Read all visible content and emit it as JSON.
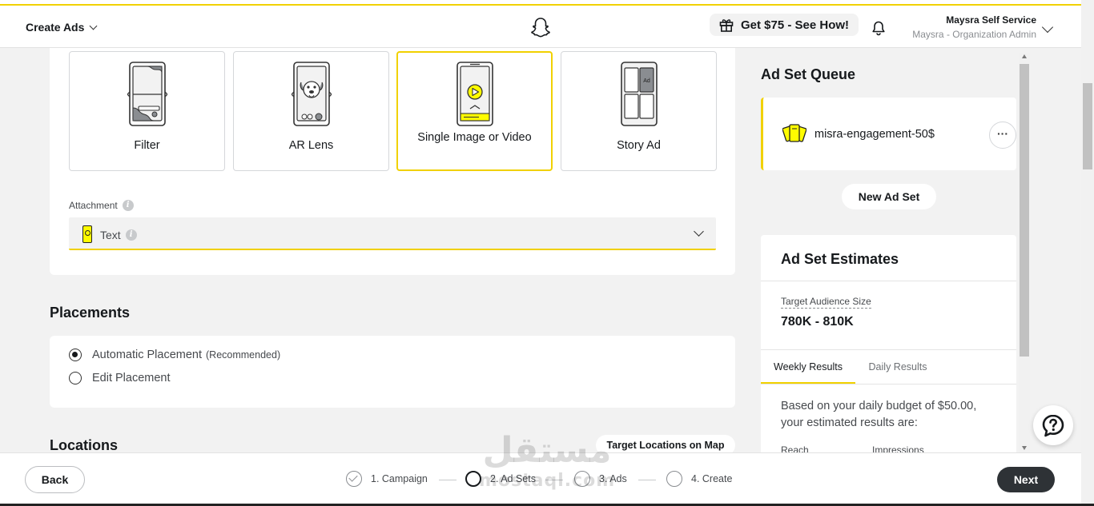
{
  "header": {
    "create_ads_label": "Create Ads",
    "promo_label": "Get $75 - See How!",
    "account_name": "Maysra Self Service",
    "account_role": "Maysra - Organization Admin"
  },
  "ad_types": [
    {
      "label": "Filter",
      "icon": "filter-icon"
    },
    {
      "label": "AR Lens",
      "icon": "ar-lens-icon"
    },
    {
      "label": "Single Image or Video",
      "icon": "single-image-video-icon",
      "selected": true
    },
    {
      "label": "Story Ad",
      "icon": "story-ad-icon",
      "badge": "Ad"
    }
  ],
  "attachment": {
    "label": "Attachment",
    "value": "Text"
  },
  "placements": {
    "title": "Placements",
    "options": [
      {
        "label": "Automatic Placement",
        "note": "(Recommended)",
        "selected": true
      },
      {
        "label": "Edit Placement",
        "selected": false
      }
    ]
  },
  "locations": {
    "title": "Locations",
    "map_button": "Target Locations on Map"
  },
  "ad_set_queue": {
    "title": "Ad Set Queue",
    "items": [
      {
        "name": "misra-engagement-50$"
      }
    ],
    "more_label": "···",
    "new_button": "New Ad Set"
  },
  "estimates": {
    "title": "Ad Set Estimates",
    "audience_label": "Target Audience Size",
    "audience_value": "780K - 810K",
    "tabs": [
      "Weekly Results",
      "Daily Results"
    ],
    "budget_text": "Based on your daily budget of $50.00, your estimated results are:",
    "metrics": [
      "Reach",
      "Impressions"
    ]
  },
  "footer": {
    "back_label": "Back",
    "next_label": "Next",
    "steps": [
      {
        "label": "1. Campaign",
        "state": "done"
      },
      {
        "label": "2. Ad Sets",
        "state": "active"
      },
      {
        "label": "3. Ads",
        "state": "todo"
      },
      {
        "label": "4. Create",
        "state": "todo"
      }
    ]
  },
  "watermark": {
    "arabic": "مستقل",
    "latin": "mostaql.com"
  },
  "colors": {
    "accent": "#f1d100",
    "primary_dark": "#2e3236"
  }
}
